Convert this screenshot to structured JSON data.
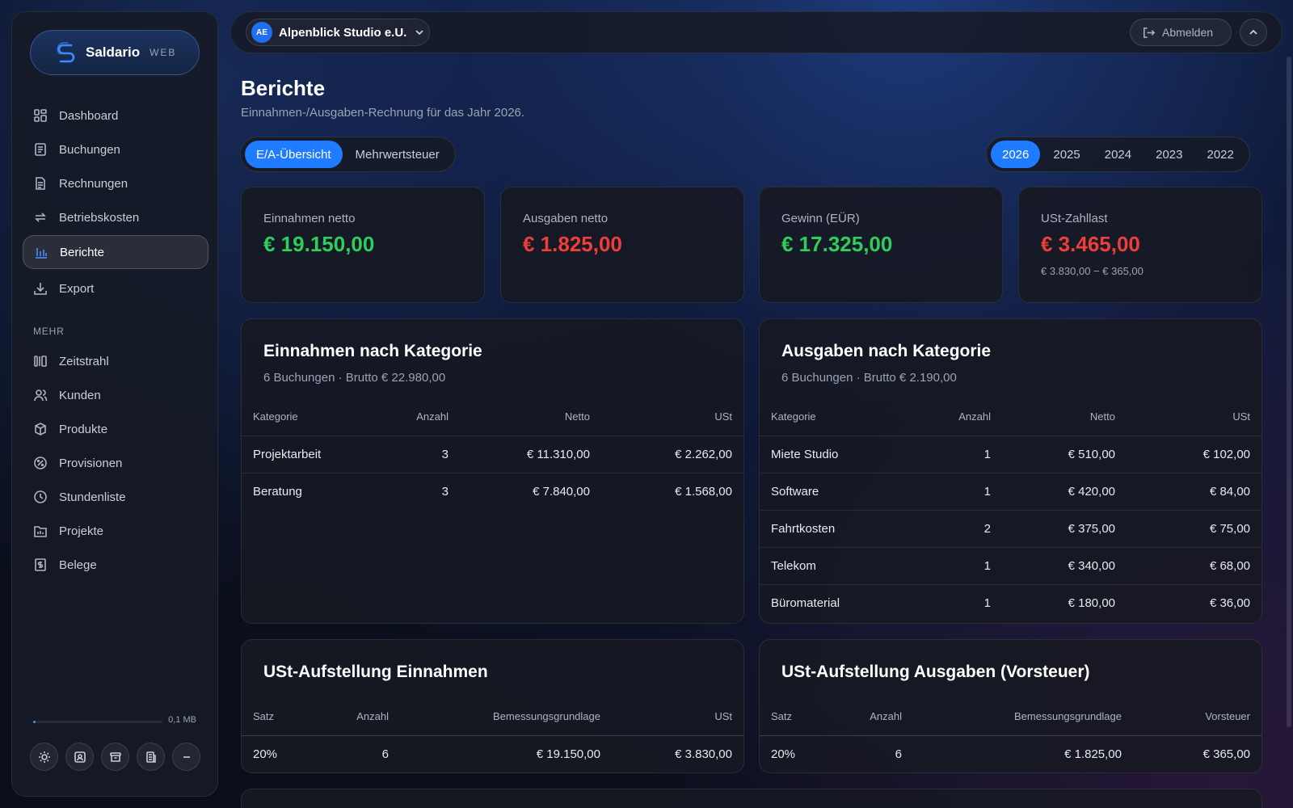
{
  "brand": {
    "name": "Saldario",
    "suffix": "WEB"
  },
  "nav": {
    "items": [
      {
        "label": "Dashboard",
        "icon": "grid-icon"
      },
      {
        "label": "Buchungen",
        "icon": "ledger-icon"
      },
      {
        "label": "Rechnungen",
        "icon": "document-icon"
      },
      {
        "label": "Betriebskosten",
        "icon": "repeat-icon"
      },
      {
        "label": "Berichte",
        "icon": "bar-chart-icon",
        "active": true
      },
      {
        "label": "Export",
        "icon": "download-icon"
      }
    ],
    "section_label": "MEHR",
    "more_items": [
      {
        "label": "Zeitstrahl",
        "icon": "timeline-icon"
      },
      {
        "label": "Kunden",
        "icon": "users-icon"
      },
      {
        "label": "Produkte",
        "icon": "package-icon"
      },
      {
        "label": "Provisionen",
        "icon": "percent-icon"
      },
      {
        "label": "Stundenliste",
        "icon": "clock-icon"
      },
      {
        "label": "Projekte",
        "icon": "folder-chart-icon"
      },
      {
        "label": "Belege",
        "icon": "receipt-icon"
      }
    ]
  },
  "storage": {
    "used": "0,1 MB",
    "fraction": 0.02
  },
  "tools": [
    "sun-icon",
    "contact-icon",
    "archive-icon",
    "building-icon",
    "minus-icon"
  ],
  "topbar": {
    "org_initials": "AE",
    "org_name": "Alpenblick Studio e.U.",
    "logout_label": "Abmelden"
  },
  "page": {
    "title": "Berichte",
    "subtitle": "Einnahmen-/Ausgaben-Rechnung für das Jahr 2026."
  },
  "tabs": [
    {
      "label": "E/A-Übersicht",
      "active": true
    },
    {
      "label": "Mehrwertsteuer",
      "active": false
    }
  ],
  "years": [
    {
      "label": "2026",
      "active": true
    },
    {
      "label": "2025"
    },
    {
      "label": "2024"
    },
    {
      "label": "2023"
    },
    {
      "label": "2022"
    }
  ],
  "kpis": [
    {
      "label": "Einnahmen netto",
      "value": "€ 19.150,00",
      "tone": "pos"
    },
    {
      "label": "Ausgaben netto",
      "value": "€ 1.825,00",
      "tone": "neg"
    },
    {
      "label": "Gewinn (EÜR)",
      "value": "€ 17.325,00",
      "tone": "pos"
    },
    {
      "label": "USt-Zahllast",
      "value": "€ 3.465,00",
      "tone": "neg",
      "note": "€ 3.830,00 − € 365,00"
    }
  ],
  "income": {
    "title": "Einnahmen nach Kategorie",
    "subtitle": "6 Buchungen · Brutto € 22.980,00",
    "columns": [
      "Kategorie",
      "Anzahl",
      "Netto",
      "USt"
    ],
    "rows": [
      [
        "Projektarbeit",
        "3",
        "€ 11.310,00",
        "€ 2.262,00"
      ],
      [
        "Beratung",
        "3",
        "€ 7.840,00",
        "€ 1.568,00"
      ]
    ]
  },
  "expenses": {
    "title": "Ausgaben nach Kategorie",
    "subtitle": "6 Buchungen · Brutto € 2.190,00",
    "columns": [
      "Kategorie",
      "Anzahl",
      "Netto",
      "USt"
    ],
    "rows": [
      [
        "Miete Studio",
        "1",
        "€ 510,00",
        "€ 102,00"
      ],
      [
        "Software",
        "1",
        "€ 420,00",
        "€ 84,00"
      ],
      [
        "Fahrtkosten",
        "2",
        "€ 375,00",
        "€ 75,00"
      ],
      [
        "Telekom",
        "1",
        "€ 340,00",
        "€ 68,00"
      ],
      [
        "Büromaterial",
        "1",
        "€ 180,00",
        "€ 36,00"
      ]
    ]
  },
  "vat_income": {
    "title": "USt-Aufstellung Einnahmen",
    "columns": [
      "Satz",
      "Anzahl",
      "Bemessungsgrundlage",
      "USt"
    ],
    "rows": [
      [
        "20%",
        "6",
        "€ 19.150,00",
        "€ 3.830,00"
      ]
    ]
  },
  "vat_expenses": {
    "title": "USt-Aufstellung Ausgaben (Vorsteuer)",
    "columns": [
      "Satz",
      "Anzahl",
      "Bemessungsgrundlage",
      "Vorsteuer"
    ],
    "rows": [
      [
        "20%",
        "6",
        "€ 1.825,00",
        "€ 365,00"
      ]
    ]
  },
  "colors": {
    "accent": "#1f7bff",
    "positive": "#2fce5a",
    "negative": "#ef3e3a"
  }
}
